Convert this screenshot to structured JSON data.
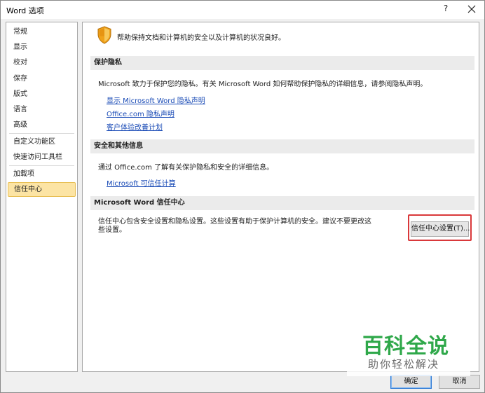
{
  "window": {
    "title": "Word 选项",
    "help_label": "?",
    "close_icon": "close-icon"
  },
  "sidebar": {
    "items": [
      {
        "label": "常规"
      },
      {
        "label": "显示"
      },
      {
        "label": "校对"
      },
      {
        "label": "保存"
      },
      {
        "label": "版式"
      },
      {
        "label": "语言"
      },
      {
        "label": "高级"
      },
      {
        "label": "自定义功能区"
      },
      {
        "label": "快速访问工具栏"
      },
      {
        "label": "加载项"
      },
      {
        "label": "信任中心",
        "selected": true
      }
    ]
  },
  "content": {
    "status_icon": "shield-icon",
    "status_text": "帮助保持文档和计算机的安全以及计算机的状况良好。",
    "privacy": {
      "header": "保护隐私",
      "description": "Microsoft 致力于保护您的隐私。有关 Microsoft Word 如何帮助保护隐私的详细信息，请参阅隐私声明。",
      "links": [
        "显示 Microsoft Word 隐私声明",
        "Office.com 隐私声明",
        "客户体验改善计划"
      ]
    },
    "security": {
      "header": "安全和其他信息",
      "description": "通过 Office.com 了解有关保护隐私和安全的详细信息。",
      "link": "Microsoft 可信任计算"
    },
    "trust_center": {
      "header": "Microsoft Word 信任中心",
      "description": "信任中心包含安全设置和隐私设置。这些设置有助于保护计算机的安全。建议不要更改这些设置。",
      "button_label": "信任中心设置(T)..."
    }
  },
  "footer": {
    "ok_label": "确定",
    "cancel_label": "取消"
  },
  "watermark": {
    "title": "百科全说",
    "subtitle": "助你轻松解决"
  },
  "colors": {
    "link": "#1a4bb6",
    "selected_bg": "#fce4a4",
    "highlight_border": "#d9383a",
    "watermark_green": "#2fa84a"
  }
}
